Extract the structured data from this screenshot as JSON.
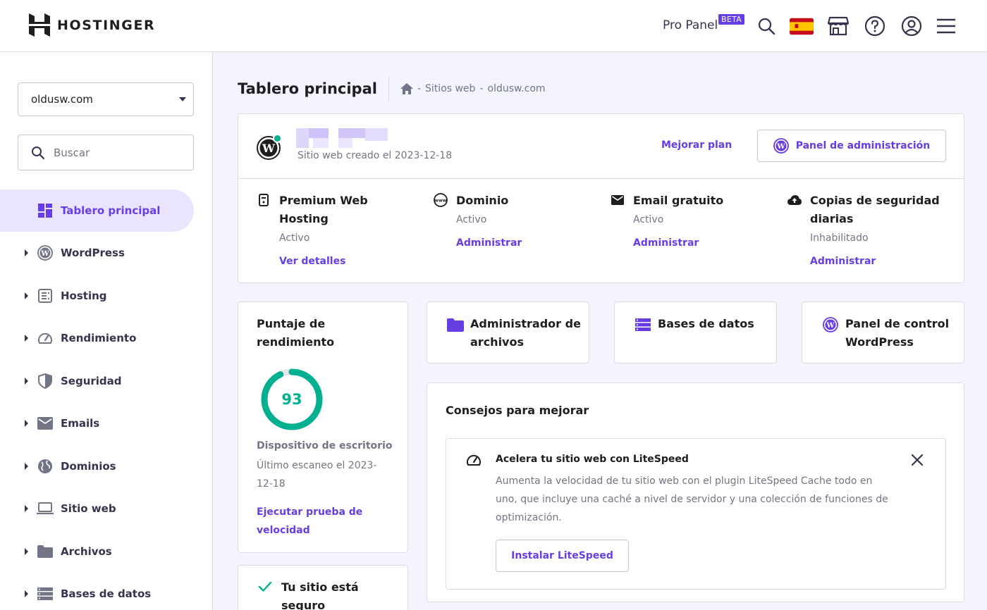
{
  "header": {
    "brand": "HOSTINGER",
    "pro_panel": "Pro Panel",
    "beta_badge": "BETA",
    "icons": [
      "search-icon",
      "flag-spain-icon",
      "store-icon",
      "help-icon",
      "account-icon",
      "menu-icon"
    ]
  },
  "sidebar": {
    "site_select": "oldusw.com",
    "search_placeholder": "Buscar",
    "items": [
      {
        "label": "Tablero principal",
        "icon": "dashboard-icon",
        "active": true
      },
      {
        "label": "WordPress",
        "icon": "wordpress-icon"
      },
      {
        "label": "Hosting",
        "icon": "server-icon"
      },
      {
        "label": "Rendimiento",
        "icon": "speedometer-icon"
      },
      {
        "label": "Seguridad",
        "icon": "shield-icon"
      },
      {
        "label": "Emails",
        "icon": "mail-icon"
      },
      {
        "label": "Dominios",
        "icon": "globe-icon"
      },
      {
        "label": "Sitio web",
        "icon": "laptop-icon"
      },
      {
        "label": "Archivos",
        "icon": "folder-icon"
      },
      {
        "label": "Bases de datos",
        "icon": "database-icon"
      }
    ]
  },
  "main": {
    "title": "Tablero principal",
    "breadcrumb": {
      "sep1": "-",
      "sites": "Sitios web",
      "sep2": "-",
      "domain": "oldusw.com"
    },
    "site": {
      "created": "Sitio web creado el 2023-12-18",
      "upgrade": "Mejorar plan",
      "admin_panel": "Panel de administración"
    },
    "features": [
      {
        "title": "Premium Web Hosting",
        "status": "Activo",
        "link": "Ver detalles",
        "icon": "hosting-plan-icon"
      },
      {
        "title": "Dominio",
        "status": "Activo",
        "link": "Administrar",
        "icon": "www-icon"
      },
      {
        "title": "Email gratuito",
        "status": "Activo",
        "link": "Administrar",
        "icon": "envelope-icon"
      },
      {
        "title": "Copias de seguridad diarias",
        "status": "Inhabilitado",
        "link": "Administrar",
        "icon": "cloud-upload-icon"
      }
    ],
    "performance": {
      "title": "Puntaje de rendimiento",
      "score": 93,
      "score_label": "93",
      "device": "Dispositivo de escritorio",
      "last_scan": "Último escaneo el 2023-12-18",
      "link": "Ejecutar prueba de velocidad"
    },
    "security": {
      "title": "Tu sitio está seguro"
    },
    "tiles": [
      {
        "label": "Administrador de archivos",
        "icon": "folder-icon"
      },
      {
        "label": "Bases de datos",
        "icon": "database-icon"
      },
      {
        "label": "Panel de control WordPress",
        "icon": "wordpress-icon"
      }
    ],
    "tips": {
      "title": "Consejos para mejorar",
      "item_title": "Acelera tu sitio web con LiteSpeed",
      "item_desc": "Aumenta la velocidad de tu sitio web con el plugin LiteSpeed Cache todo en uno, que incluye una caché a nivel de servidor y una colección de funciones de optimización.",
      "button": "Instalar LiteSpeed"
    }
  },
  "colors": {
    "accent": "#673de6",
    "accent_light": "#ebe4ff",
    "success": "#00b090",
    "text": "#1d1e20",
    "muted": "#727586",
    "background": "#f4f4fe"
  }
}
